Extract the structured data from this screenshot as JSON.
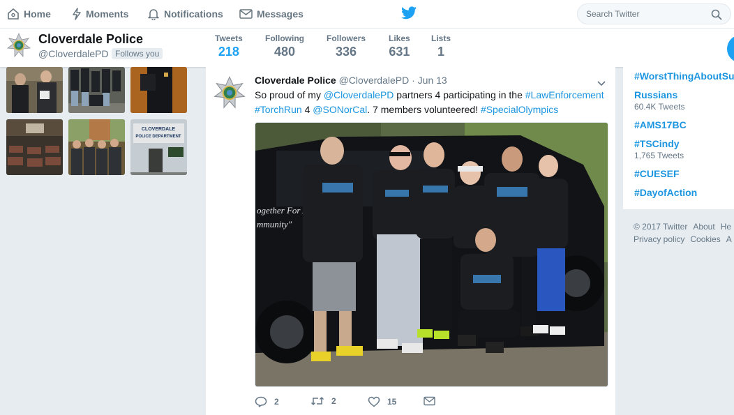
{
  "topnav": {
    "items": [
      {
        "label": "Home",
        "icon": "home-icon"
      },
      {
        "label": "Moments",
        "icon": "lightning-icon"
      },
      {
        "label": "Notifications",
        "icon": "bell-icon"
      },
      {
        "label": "Messages",
        "icon": "envelope-icon"
      }
    ],
    "logo_icon": "twitter-bird-icon",
    "search_placeholder": "Search Twitter",
    "accent": "#1da1f2"
  },
  "profile": {
    "name": "Cloverdale Police",
    "handle": "@CloverdalePD",
    "follows_you": "Follows you",
    "stats": [
      {
        "label": "Tweets",
        "value": "218",
        "active": true
      },
      {
        "label": "Following",
        "value": "480"
      },
      {
        "label": "Followers",
        "value": "336"
      },
      {
        "label": "Likes",
        "value": "631"
      },
      {
        "label": "Lists",
        "value": "1"
      }
    ]
  },
  "tweet": {
    "name": "Cloverdale Police",
    "handle": "@CloverdalePD",
    "dot": "·",
    "date": "Jun 13",
    "text_parts": [
      {
        "text": "So proud of my ",
        "link": false
      },
      {
        "text": "@CloverdalePD",
        "link": true
      },
      {
        "text": " partners 4 participating in the ",
        "link": false
      },
      {
        "text": "#LawEnforcement",
        "link": true
      },
      {
        "text": " ",
        "link": false
      },
      {
        "text": "#TorchRun",
        "link": true
      },
      {
        "text": " 4 ",
        "link": false
      },
      {
        "text": "@SONorCal",
        "link": true
      },
      {
        "text": ". 7 members volunteered! ",
        "link": false
      },
      {
        "text": "#SpecialOlympics",
        "link": true
      }
    ],
    "photo_text": "ogether For A\nmmunity\"",
    "actions": {
      "replies": "2",
      "retweets": "2",
      "likes": "15"
    }
  },
  "trends": [
    {
      "name": "#WorstThingAboutSu",
      "meta": ""
    },
    {
      "name": "Russians",
      "meta": "60.4K Tweets"
    },
    {
      "name": "#AMS17BC",
      "meta": ""
    },
    {
      "name": "#TSCindy",
      "meta": "1,765 Tweets"
    },
    {
      "name": "#CUESEF",
      "meta": ""
    },
    {
      "name": "#DayofAction",
      "meta": ""
    }
  ],
  "footer": {
    "copyright": "© 2017 Twitter",
    "about": "About",
    "help": "He",
    "privacy": "Privacy policy",
    "cookies": "Cookies",
    "ads": "A"
  },
  "photo_grid_sign": {
    "line1": "CLOVERDALE",
    "line2": "POLICE DEPARTMENT"
  }
}
